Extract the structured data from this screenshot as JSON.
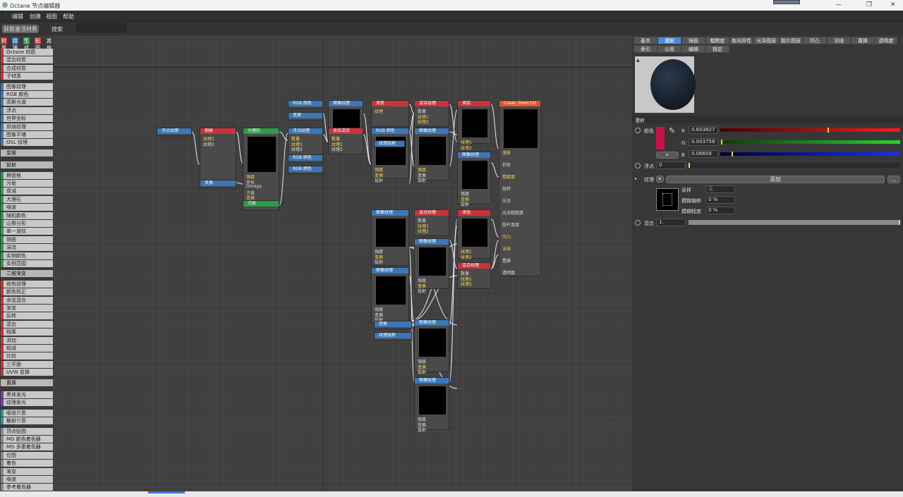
{
  "titlebar": {
    "title": "Octane 节点编辑器",
    "minimize": "—",
    "restore": "❐",
    "close": "✕"
  },
  "menu": [
    "编辑",
    "创建",
    "视图",
    "帮助"
  ],
  "toolbar": {
    "get_active": "获取激活材质",
    "search_label": "搜索"
  },
  "categories": [
    {
      "label": "材质",
      "color": "#c8343b"
    },
    {
      "label": "纹理",
      "color": "#3b77b8"
    },
    {
      "label": "生成",
      "color": "#2e9a4a"
    },
    {
      "label": "贴图",
      "color": "#c8343b"
    },
    {
      "label": "其他",
      "color": "#444"
    },
    {
      "label": "发光",
      "color": "#7a3aa5"
    },
    {
      "label": "介质",
      "color": "#1f9b9b"
    },
    {
      "label": "C4D",
      "color": "#888"
    }
  ],
  "left_items": [
    {
      "label": "Octane 材质",
      "color": "#c8343b"
    },
    {
      "label": "混合材质",
      "color": "#c8343b"
    },
    {
      "label": "合成材质",
      "color": "#c8343b"
    },
    {
      "label": "子材质",
      "color": "#c8343b"
    },
    {
      "label": "图像纹理",
      "color": "#3b77b8",
      "gap": true
    },
    {
      "label": "RGB 颜色",
      "color": "#3b77b8"
    },
    {
      "label": "高斯光谱",
      "color": "#3b77b8"
    },
    {
      "label": "浮点",
      "color": "#3b77b8"
    },
    {
      "label": "世界坐标",
      "color": "#3b77b8"
    },
    {
      "label": "烘焙纹理",
      "color": "#3b77b8"
    },
    {
      "label": "图像平铺",
      "color": "#3b77b8"
    },
    {
      "label": "OSL 纹理",
      "color": "#3b77b8"
    },
    {
      "label": "变换",
      "color": "#555",
      "header": true
    },
    {
      "label": "投射",
      "color": "#555",
      "header": true
    },
    {
      "label": "棋盘格",
      "color": "#2e9a4a"
    },
    {
      "label": "污垢",
      "color": "#2e9a4a"
    },
    {
      "label": "衰减",
      "color": "#2e9a4a"
    },
    {
      "label": "大理石",
      "color": "#2e9a4a"
    },
    {
      "label": "噪波",
      "color": "#2e9a4a"
    },
    {
      "label": "随机颜色",
      "color": "#2e9a4a"
    },
    {
      "label": "山脊分形",
      "color": "#2e9a4a"
    },
    {
      "label": "单一波纹",
      "color": "#2e9a4a"
    },
    {
      "label": "侧面",
      "color": "#2e9a4a"
    },
    {
      "label": "湍流",
      "color": "#2e9a4a"
    },
    {
      "label": "实例颜色",
      "color": "#2e9a4a"
    },
    {
      "label": "实例范围",
      "color": "#2e9a4a"
    },
    {
      "label": "二维渐变",
      "color": "#555",
      "header": true
    },
    {
      "label": "修剪纹理",
      "color": "#c8343b"
    },
    {
      "label": "颜色校正",
      "color": "#c8343b"
    },
    {
      "label": "余弦混合",
      "color": "#c8343b"
    },
    {
      "label": "渐变",
      "color": "#c8343b"
    },
    {
      "label": "反转",
      "color": "#c8343b"
    },
    {
      "label": "混合",
      "color": "#c8343b"
    },
    {
      "label": "相乘",
      "color": "#c8343b"
    },
    {
      "label": "添加",
      "color": "#c8343b"
    },
    {
      "label": "相减",
      "color": "#c8343b"
    },
    {
      "label": "比较",
      "color": "#c8343b"
    },
    {
      "label": "三平面",
      "color": "#c8343b"
    },
    {
      "label": "UVW 变换",
      "color": "#c8343b"
    },
    {
      "label": "置换",
      "color": "#c8a23b",
      "header": true
    },
    {
      "label": "黑体发光",
      "color": "#7a3aa5",
      "gap": true
    },
    {
      "label": "纹理发光",
      "color": "#7a3aa5"
    },
    {
      "label": "吸收介质",
      "color": "#1f9b9b",
      "gap": true
    },
    {
      "label": "散射介质",
      "color": "#1f9b9b"
    },
    {
      "label": "顶点贴图",
      "color": "#888",
      "gap": true
    },
    {
      "label": "MG 颜色着色器",
      "color": "#888"
    },
    {
      "label": "MG 多重着色器",
      "color": "#888"
    },
    {
      "label": "位图",
      "color": "#888"
    },
    {
      "label": "着色",
      "color": "#888"
    },
    {
      "label": "渐变",
      "color": "#888"
    },
    {
      "label": "噪波",
      "color": "#888"
    },
    {
      "label": "参考着色器",
      "color": "#888"
    }
  ],
  "nodes": [
    {
      "title": "浮点纹理",
      "color": "#3b77b8",
      "pins": []
    },
    {
      "title": "相乘",
      "color": "#c8343b",
      "pins": [
        {
          "l": "纹理1",
          "y": true
        },
        {
          "l": "纹理2"
        }
      ]
    },
    {
      "title": "变换",
      "color": "#3b77b8",
      "pins": []
    },
    {
      "title": "大理石",
      "color": "#2e9a4a",
      "pins": [
        {
          "l": "强度",
          "y": true
        },
        {
          "l": "步长"
        },
        {
          "l": "Omega"
        },
        {
          "l": "方差"
        },
        {
          "l": "变换",
          "y": true
        },
        {
          "l": "投射"
        }
      ]
    },
    {
      "title": "污垢",
      "color": "#2e9a4a",
      "pins": []
    },
    {
      "title": "RGB 颜色",
      "color": "#3b77b8",
      "pins": []
    },
    {
      "title": "变换",
      "color": "#3b77b8",
      "pins": []
    },
    {
      "title": "浮点纹理",
      "color": "#3b77b8",
      "pins": [
        {
          "l": "数量",
          "y": true
        },
        {
          "l": "纹理1",
          "y": true
        },
        {
          "l": "纹理2"
        }
      ]
    },
    {
      "title": "RGB 颜色",
      "color": "#3b77b8",
      "pins": []
    },
    {
      "title": "RGB 颜色",
      "color": "#3b77b8",
      "pins": []
    },
    {
      "title": "图像纹理",
      "color": "#3b77b8",
      "pins": []
    },
    {
      "title": "余弦混合",
      "color": "#c8343b",
      "pins": [
        {
          "l": "数量",
          "y": true
        },
        {
          "l": "纹理1",
          "y": true
        },
        {
          "l": "纹理2"
        }
      ]
    },
    {
      "title": "渐变",
      "color": "#c8343b",
      "pins": [
        {
          "l": "纹理",
          "y": true
        }
      ]
    },
    {
      "title": "RGB 颜色",
      "color": "#3b77b8",
      "pins": [
        {
          "l": "强度",
          "y": true
        },
        {
          "l": "变换",
          "y": true
        },
        {
          "l": "投射"
        }
      ]
    },
    {
      "title": "纹理投射",
      "color": "#3b77b8",
      "pins": []
    },
    {
      "title": "混合纹理",
      "color": "#c8343b",
      "pins": [
        {
          "l": "数量"
        },
        {
          "l": "纹理1",
          "y": true
        },
        {
          "l": "纹理2",
          "y": true
        }
      ]
    },
    {
      "title": "图像纹理",
      "color": "#3b77b8",
      "pins": [
        {
          "l": "强度",
          "y": true
        },
        {
          "l": "变换"
        },
        {
          "l": "投射"
        }
      ]
    },
    {
      "title": "添加",
      "color": "#c8343b",
      "pins": [
        {
          "l": "纹理1",
          "y": true
        },
        {
          "l": "纹理2",
          "y": true
        }
      ]
    },
    {
      "title": "图像纹理",
      "color": "#3b77b8",
      "pins": [
        {
          "l": "强度"
        },
        {
          "l": "变换",
          "y": true
        },
        {
          "l": "投射"
        }
      ]
    },
    {
      "title": "Cover_Front.txt",
      "color": "#e0562a",
      "pins": [
        {
          "l": "漫射",
          "y": true
        },
        {
          "l": "折射"
        },
        {
          "l": "粗糙度",
          "y": true
        },
        {
          "l": "旋转"
        },
        {
          "l": "光泽"
        },
        {
          "l": "光泽粗糙度"
        },
        {
          "l": "胶片宽度"
        },
        {
          "l": "凹凸",
          "y": true
        },
        {
          "l": "法线",
          "y": true
        },
        {
          "l": "置换"
        },
        {
          "l": "透明度"
        }
      ]
    },
    {
      "title": "图像纹理",
      "color": "#3b77b8",
      "pins": [
        {
          "l": "强度"
        },
        {
          "l": "变换",
          "y": true
        },
        {
          "l": "投射"
        }
      ]
    },
    {
      "title": "混合纹理",
      "color": "#c8343b",
      "pins": [
        {
          "l": "数量"
        },
        {
          "l": "纹理1",
          "y": true
        },
        {
          "l": "纹理2",
          "y": true
        }
      ]
    },
    {
      "title": "添加",
      "color": "#c8343b",
      "pins": [
        {
          "l": "纹理1",
          "y": true
        },
        {
          "l": "纹理2",
          "y": true
        }
      ]
    },
    {
      "title": "图像纹理",
      "color": "#3b77b8",
      "pins": [
        {
          "l": "强度"
        },
        {
          "l": "变换",
          "y": true
        },
        {
          "l": "投射"
        }
      ]
    },
    {
      "title": "图像纹理",
      "color": "#3b77b8",
      "pins": [
        {
          "l": "强度"
        },
        {
          "l": "变换"
        },
        {
          "l": "投射"
        }
      ]
    },
    {
      "title": "混合纹理",
      "color": "#c8343b",
      "pins": [
        {
          "l": "数量"
        },
        {
          "l": "纹理1",
          "y": true
        },
        {
          "l": "纹理2",
          "y": true
        }
      ]
    },
    {
      "title": "变换",
      "color": "#3b77b8",
      "pins": []
    },
    {
      "title": "纹理投射",
      "color": "#3b77b8",
      "pins": []
    },
    {
      "title": "图像纹理",
      "color": "#3b77b8",
      "pins": [
        {
          "l": "强度"
        },
        {
          "l": "变换",
          "y": true
        },
        {
          "l": "投射"
        }
      ]
    },
    {
      "title": "图像纹理",
      "color": "#3b77b8",
      "pins": [
        {
          "l": "强度"
        },
        {
          "l": "变换"
        },
        {
          "l": "投射"
        }
      ]
    }
  ],
  "right": {
    "tabs_row1": [
      "基本",
      "漫射",
      "镜面",
      "粗糙度",
      "各向异性",
      "光泽图层",
      "胶片图层",
      "凹凸",
      "法线",
      "置换",
      "透明度"
    ],
    "tabs_row2": [
      "索引",
      "公用",
      "编辑",
      "指定"
    ],
    "active_tab": "漫射",
    "section": "漫射",
    "color_label": "颜色",
    "swatch": "#c4154b",
    "r": {
      "label": "R",
      "value": "0.603827"
    },
    "g": {
      "label": "G",
      "value": "0.003758"
    },
    "b": {
      "label": "B",
      "value": "0.06656"
    },
    "float_label": "浮点",
    "float_value": "0",
    "texture_label": "纹理",
    "texture_btn": "添加",
    "texture_more": "...",
    "sampling_label": "采样",
    "sampling_value": "无",
    "blur_offset_label": "模糊偏移",
    "blur_offset_value": "0 %",
    "blur_level_label": "模糊程度",
    "blur_level_value": "0 %",
    "mix_label": "混合",
    "mix_value": "1."
  }
}
